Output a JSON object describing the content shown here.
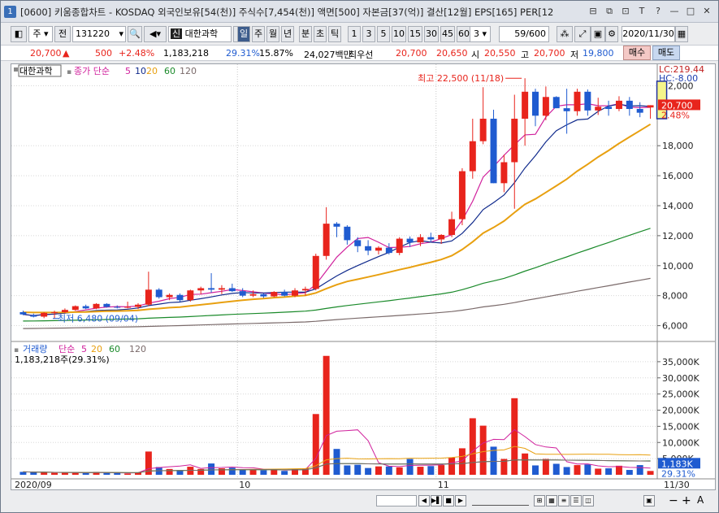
{
  "window": {
    "number": "1",
    "title": "[0600] 키움종합차트 - KOSDAQ 외국인보유[54(천)] 주식수[7,454(천)] 액면[500] 자본금[37(억)] 결산[12월] EPS[165] PER[12",
    "controls": [
      "⊟",
      "⧉",
      "⊡",
      "T",
      "?",
      "—",
      "□",
      "✕"
    ]
  },
  "toolbar": {
    "period_type": "주",
    "prev_label": "전",
    "code": "131220",
    "stock_name": "대한과학",
    "tag_sin": "신",
    "intervals": [
      "일",
      "주",
      "월",
      "년",
      "분",
      "초",
      "틱"
    ],
    "active_interval": "일",
    "minute_values": [
      "1",
      "3",
      "5",
      "10",
      "15",
      "30",
      "45",
      "60"
    ],
    "interval_input": "3",
    "count": "59/600",
    "date": "2020/11/30"
  },
  "quote": {
    "price": "20,700",
    "arrow": "▲",
    "change": "500",
    "change_pct": "+2.48%",
    "volume": "1,183,218",
    "vol_pct": "29.31%",
    "turnover": "15.87%",
    "amount": "24,027백만",
    "best_label": "최우선",
    "ask": "20,700",
    "bid": "20,650",
    "open_label": "시",
    "open": "20,550",
    "high_label": "고",
    "high": "20,700",
    "low_label": "저",
    "low": "19,800",
    "buy_label": "매수",
    "sell_label": "매도"
  },
  "price_chart": {
    "stock_label": "대한과학",
    "legend_prefix": "종가 단순",
    "ma_labels": [
      "5",
      "10",
      "20",
      "60",
      "120"
    ],
    "lc": "LC:219.44",
    "hc": "HC:-8.00",
    "high_annotation": "최고 22,500 (11/18)",
    "low_annotation": "최저 6,480 (09/04)",
    "current_price": "20,700",
    "current_pct": "2.48%",
    "y_ticks": [
      "22,000",
      "18,000",
      "16,000",
      "14,000",
      "12,000",
      "10,000",
      "8,000",
      "6,000"
    ]
  },
  "volume_chart": {
    "title": "거래량",
    "legend_prefix": "단순",
    "ma_labels": [
      "5",
      "20",
      "60",
      "120"
    ],
    "value_text": "1,183,218주(29.31%)",
    "current": "1,183K",
    "current_pct": "29.31%",
    "y_ticks": [
      "35,000K",
      "30,000K",
      "25,000K",
      "20,000K",
      "15,000K",
      "10,000K",
      "5,000K"
    ]
  },
  "x_axis": {
    "labels": [
      "2020/09",
      "10",
      "11"
    ],
    "end_label": "11/30"
  },
  "bottom": {
    "zoom_minus": "−",
    "zoom_plus": "+",
    "text_a": "A"
  },
  "colors": {
    "up": "#e8241c",
    "down": "#1f5bd0",
    "ma5": "#d0209c",
    "ma10": "#102a8c",
    "ma20": "#e8a010",
    "ma60": "#1a8a2a",
    "ma120": "#7a6a6a"
  },
  "chart_data": {
    "type": "candlestick",
    "x": [
      "09/01",
      "09/02",
      "09/03",
      "09/04",
      "09/07",
      "09/08",
      "09/09",
      "09/10",
      "09/11",
      "09/14",
      "09/15",
      "09/16",
      "09/17",
      "09/18",
      "09/21",
      "09/22",
      "09/23",
      "09/24",
      "09/25",
      "09/28",
      "09/29",
      "10/05",
      "10/06",
      "10/07",
      "10/08",
      "10/12",
      "10/13",
      "10/14",
      "10/15",
      "10/16",
      "10/19",
      "10/20",
      "10/21",
      "10/22",
      "10/23",
      "10/26",
      "10/27",
      "10/28",
      "10/29",
      "10/30",
      "11/02",
      "11/03",
      "11/04",
      "11/05",
      "11/06",
      "11/09",
      "11/10",
      "11/11",
      "11/12",
      "11/13",
      "11/16",
      "11/17",
      "11/18",
      "11/19",
      "11/20",
      "11/23",
      "11/24",
      "11/25",
      "11/26",
      "11/27",
      "11/30"
    ],
    "ohlc": [
      [
        6900,
        7000,
        6700,
        6750
      ],
      [
        6700,
        6800,
        6550,
        6600
      ],
      [
        6600,
        6900,
        6500,
        6850
      ],
      [
        6850,
        7000,
        6480,
        6900
      ],
      [
        6900,
        7150,
        6850,
        7050
      ],
      [
        7050,
        7350,
        7000,
        7300
      ],
      [
        7300,
        7400,
        7100,
        7150
      ],
      [
        7150,
        7500,
        7100,
        7450
      ],
      [
        7450,
        7500,
        7200,
        7250
      ],
      [
        7250,
        7350,
        7150,
        7200
      ],
      [
        7200,
        7600,
        7150,
        7250
      ],
      [
        7250,
        7500,
        7100,
        7400
      ],
      [
        7400,
        9600,
        7300,
        8400
      ],
      [
        8400,
        8500,
        7800,
        7900
      ],
      [
        7900,
        8150,
        7700,
        8050
      ],
      [
        8050,
        8150,
        7600,
        7700
      ],
      [
        7700,
        8400,
        7600,
        8350
      ],
      [
        8350,
        8600,
        8100,
        8500
      ],
      [
        8500,
        9500,
        8200,
        8400
      ],
      [
        8400,
        8700,
        8100,
        8500
      ],
      [
        8500,
        8800,
        8250,
        8300
      ],
      [
        8300,
        8500,
        7900,
        8000
      ],
      [
        8000,
        8350,
        7900,
        8100
      ],
      [
        8100,
        8150,
        7850,
        7950
      ],
      [
        7950,
        8300,
        7900,
        8250
      ],
      [
        8250,
        8400,
        7950,
        8000
      ],
      [
        8000,
        8500,
        7900,
        8350
      ],
      [
        8350,
        8600,
        8000,
        8450
      ],
      [
        8450,
        10800,
        8350,
        10650
      ],
      [
        10650,
        13900,
        10400,
        12800
      ],
      [
        12800,
        12900,
        11900,
        12600
      ],
      [
        12600,
        12700,
        11400,
        11700
      ],
      [
        11700,
        11900,
        10900,
        11300
      ],
      [
        11300,
        11700,
        10700,
        11000
      ],
      [
        11000,
        11300,
        10750,
        11200
      ],
      [
        11200,
        11500,
        10750,
        10850
      ],
      [
        10850,
        11900,
        10700,
        11800
      ],
      [
        11800,
        11950,
        11250,
        11550
      ],
      [
        11550,
        12100,
        11300,
        11900
      ],
      [
        11900,
        12200,
        11600,
        11750
      ],
      [
        11750,
        12100,
        11450,
        12050
      ],
      [
        12050,
        13600,
        11900,
        13100
      ],
      [
        13100,
        16500,
        12700,
        16300
      ],
      [
        16300,
        19800,
        15800,
        18300
      ],
      [
        18300,
        21900,
        18100,
        19800
      ],
      [
        19800,
        20400,
        15500,
        15500
      ],
      [
        15500,
        17400,
        14900,
        16900
      ],
      [
        16900,
        21400,
        13800,
        19800
      ],
      [
        19800,
        22500,
        18000,
        21600
      ],
      [
        21600,
        21800,
        19300,
        20000
      ],
      [
        20000,
        21950,
        19700,
        21250
      ],
      [
        21250,
        21300,
        20500,
        20500
      ],
      [
        20500,
        21800,
        18800,
        20300
      ],
      [
        20300,
        21800,
        20000,
        21600
      ],
      [
        21600,
        21750,
        20000,
        20350
      ],
      [
        20350,
        21200,
        20050,
        20600
      ],
      [
        20600,
        21000,
        20000,
        20450
      ],
      [
        20450,
        21300,
        20300,
        21000
      ],
      [
        21000,
        21250,
        20000,
        20450
      ],
      [
        20450,
        20900,
        19900,
        20200
      ],
      [
        20550,
        20700,
        19800,
        20700
      ]
    ],
    "volume_k": [
      900,
      800,
      700,
      600,
      650,
      700,
      500,
      900,
      600,
      500,
      400,
      700,
      7200,
      2400,
      1800,
      1500,
      2500,
      1800,
      3500,
      2000,
      2200,
      1600,
      1500,
      1400,
      1600,
      1200,
      1800,
      2000,
      18800,
      36800,
      8000,
      2900,
      3100,
      2100,
      2600,
      2600,
      2300,
      4900,
      2500,
      2700,
      3000,
      5300,
      8200,
      17500,
      15200,
      8700,
      4900,
      23700,
      6600,
      2900,
      4900,
      3400,
      2400,
      3000,
      3200,
      1900,
      2000,
      2800,
      1500,
      3000,
      1183
    ],
    "ma_periods": [
      5,
      10,
      20,
      60,
      120
    ],
    "ylim_price": [
      5000,
      23000
    ],
    "ylim_volume_k": [
      0,
      39000
    ]
  }
}
